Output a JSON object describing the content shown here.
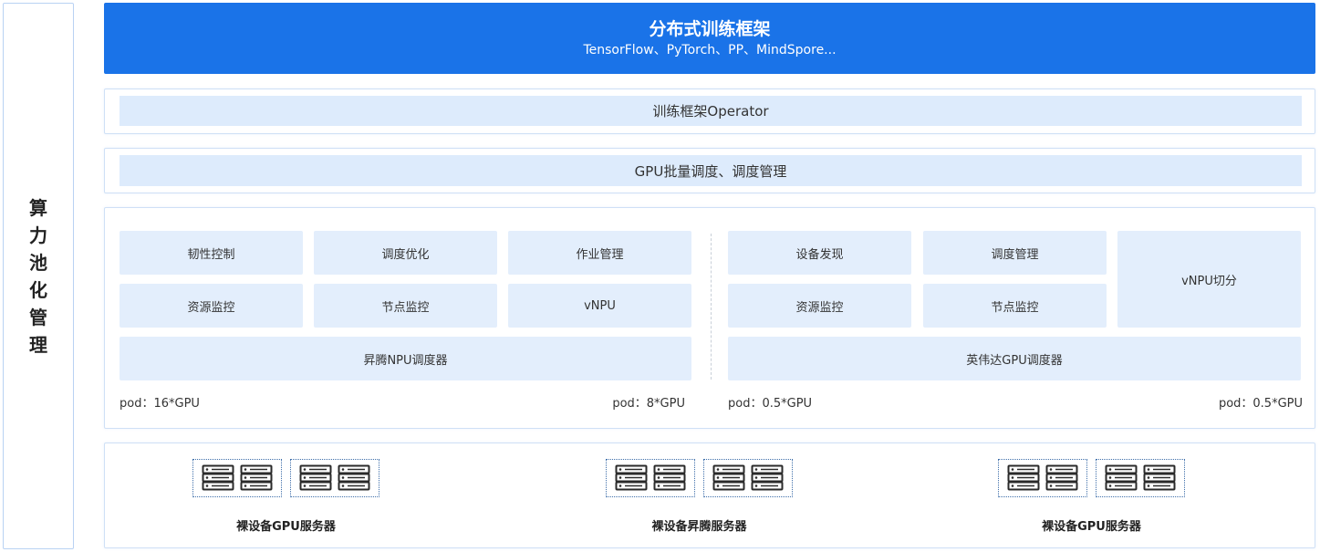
{
  "side_label": [
    "算",
    "力",
    "池",
    "化",
    "管",
    "理"
  ],
  "framework": {
    "title": "分布式训练框架",
    "subtitle": "TensorFlow、PyTorch、PP、MindSpore..."
  },
  "operator_label": "训练框架Operator",
  "scheduler_label": "GPU批量调度、调度管理",
  "npu": {
    "cells": [
      "韧性控制",
      "调度优化",
      "作业管理",
      "资源监控",
      "节点监控",
      "vNPU"
    ],
    "scheduler": "昇腾NPU调度器",
    "pod_left": "pod：16*GPU",
    "pod_right": "pod：8*GPU"
  },
  "gpu": {
    "cells": [
      "设备发现",
      "调度管理",
      "资源监控",
      "节点监控"
    ],
    "vnpu_split": "vNPU切分",
    "scheduler": "英伟达GPU调度器",
    "pod_left": "pod：0.5*GPU",
    "pod_right": "pod：0.5*GPU"
  },
  "servers": [
    {
      "label": "裸设备GPU服务器"
    },
    {
      "label": "裸设备昇腾服务器"
    },
    {
      "label": "裸设备GPU服务器"
    }
  ],
  "colors": {
    "primary": "#1a73e8",
    "light_fill": "#e3eefc",
    "strip_fill": "#ddebfc",
    "border": "#cfe0f6"
  }
}
